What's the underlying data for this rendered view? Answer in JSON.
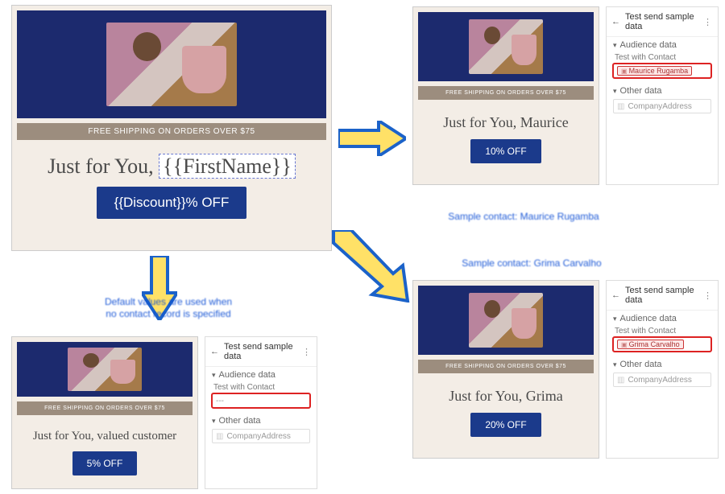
{
  "brand_navy": "#1c2a6e",
  "cta_blue": "#1b3a8b",
  "ship_bar_label": "FREE SHIPPING ON ORDERS OVER $75",
  "template": {
    "headline_prefix": "Just for You, ",
    "firstname_token": "{{FirstName}}",
    "discount_token": "{{Discount}}",
    "cta_suffix": "% OFF"
  },
  "previews": {
    "maurice": {
      "headline": "Just for You, Maurice",
      "cta": "10% OFF"
    },
    "grima": {
      "headline": "Just for You, Grima",
      "cta": "20% OFF"
    },
    "default": {
      "headline": "Just for You, valued customer",
      "cta": "5% OFF"
    }
  },
  "panel": {
    "title": "Test send sample data",
    "section_audience": "Audience data",
    "section_other": "Other data",
    "label_test_with_contact": "Test with Contact",
    "label_company_address": "CompanyAddress",
    "contact_maurice": "Maurice Rugamba",
    "contact_grima": "Grima Carvalho",
    "contact_empty": "---"
  },
  "annotations": {
    "maurice": "Sample contact: Maurice Rugamba",
    "grima": "Sample contact: Grima Carvalho",
    "default": "Default values are used when\nno contact record is specified"
  }
}
